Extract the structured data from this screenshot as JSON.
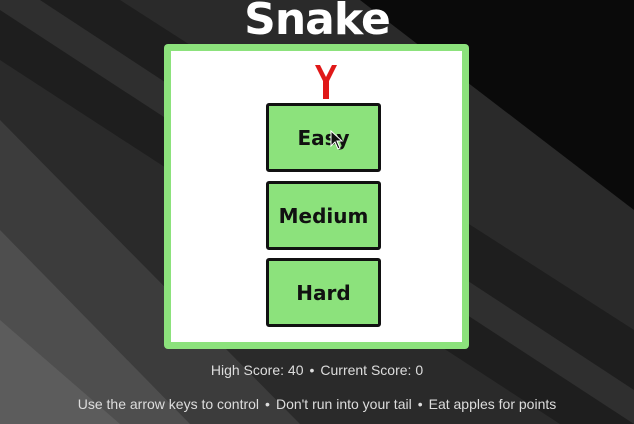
{
  "game": {
    "title": "Snake"
  },
  "menu": {
    "easy_label": "Easy",
    "medium_label": "Medium",
    "hard_label": "Hard"
  },
  "scores": {
    "high_score_text": "High Score: 40",
    "current_score_text": "Current Score: 0",
    "separator": "•"
  },
  "instructions": {
    "items": [
      "Use the arrow keys to control",
      "Don't run into your tail",
      "Eat apples for points"
    ],
    "separator": "•"
  },
  "colors": {
    "board_green": "#8ce27c",
    "board_inner": "#ffffff",
    "button_border": "#111111",
    "tongue_red": "#e01818",
    "title_text": "#ffffff",
    "footer_text": "#dddddd"
  },
  "icons": {
    "tongue": "snake-tongue-icon",
    "cursor": "mouse-pointer-icon"
  }
}
